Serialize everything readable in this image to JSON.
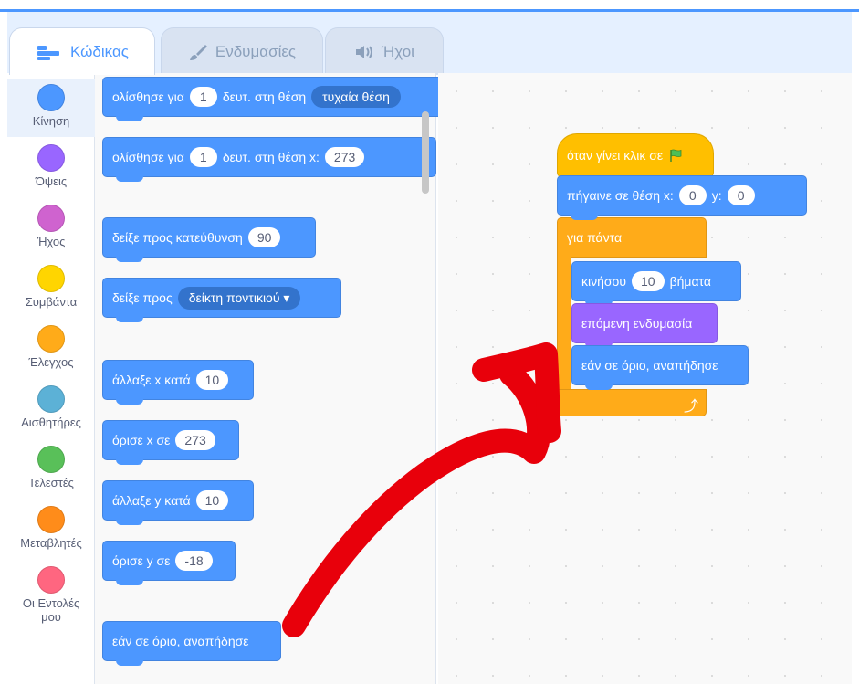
{
  "tabs": [
    {
      "label": "Κώδικας",
      "icon": "code-icon",
      "active": true
    },
    {
      "label": "Ενδυμασίες",
      "icon": "brush-icon",
      "active": false
    },
    {
      "label": "Ήχοι",
      "icon": "speaker-icon",
      "active": false
    }
  ],
  "categories": [
    {
      "label": "Κίνηση",
      "color": "#4c97ff"
    },
    {
      "label": "Όψεις",
      "color": "#9966ff"
    },
    {
      "label": "Ήχος",
      "color": "#cf63cf"
    },
    {
      "label": "Συμβάντα",
      "color": "#ffd500"
    },
    {
      "label": "Έλεγχος",
      "color": "#ffab19"
    },
    {
      "label": "Αισθητήρες",
      "color": "#5cb1d6"
    },
    {
      "label": "Τελεστές",
      "color": "#59c059"
    },
    {
      "label": "Μεταβλητές",
      "color": "#ff8c1a"
    },
    {
      "label": "Οι Εντολές",
      "label2": "μου",
      "color": "#ff6680"
    }
  ],
  "palette": {
    "glide_random": {
      "t1": "ολίσθησε για",
      "v1": "1",
      "t2": "δευτ. στη θέση",
      "dd": "τυχαία θέση"
    },
    "glide_xy": {
      "t1": "ολίσθησε για",
      "v1": "1",
      "t2": "δευτ. στη θέση x:",
      "v2": "273"
    },
    "point_dir": {
      "t1": "δείξε προς κατεύθυνση",
      "v1": "90"
    },
    "point_towards": {
      "t1": "δείξε προς",
      "dd": "δείκτη ποντικιού"
    },
    "change_x": {
      "t1": "άλλαξε x κατά",
      "v1": "10"
    },
    "set_x": {
      "t1": "όρισε x σε",
      "v1": "273"
    },
    "change_y": {
      "t1": "άλλαξε y κατά",
      "v1": "10"
    },
    "set_y": {
      "t1": "όρισε y σε",
      "v1": "-18"
    },
    "bounce": {
      "t1": "εάν σε όριο, αναπήδησε"
    }
  },
  "script": {
    "hat": {
      "t1": "όταν γίνει κλικ σε"
    },
    "goto": {
      "t1": "πήγαινε σε θέση x:",
      "v1": "0",
      "t2": "y:",
      "v2": "0"
    },
    "forever": {
      "t1": "για πάντα"
    },
    "move": {
      "t1": "κινήσου",
      "v1": "10",
      "t2": "βήματα"
    },
    "next_costume": {
      "t1": "επόμενη ενδυμασία"
    },
    "bounce": {
      "t1": "εάν σε όριο, αναπήδησε"
    }
  },
  "annotation_color": "#e8000b"
}
